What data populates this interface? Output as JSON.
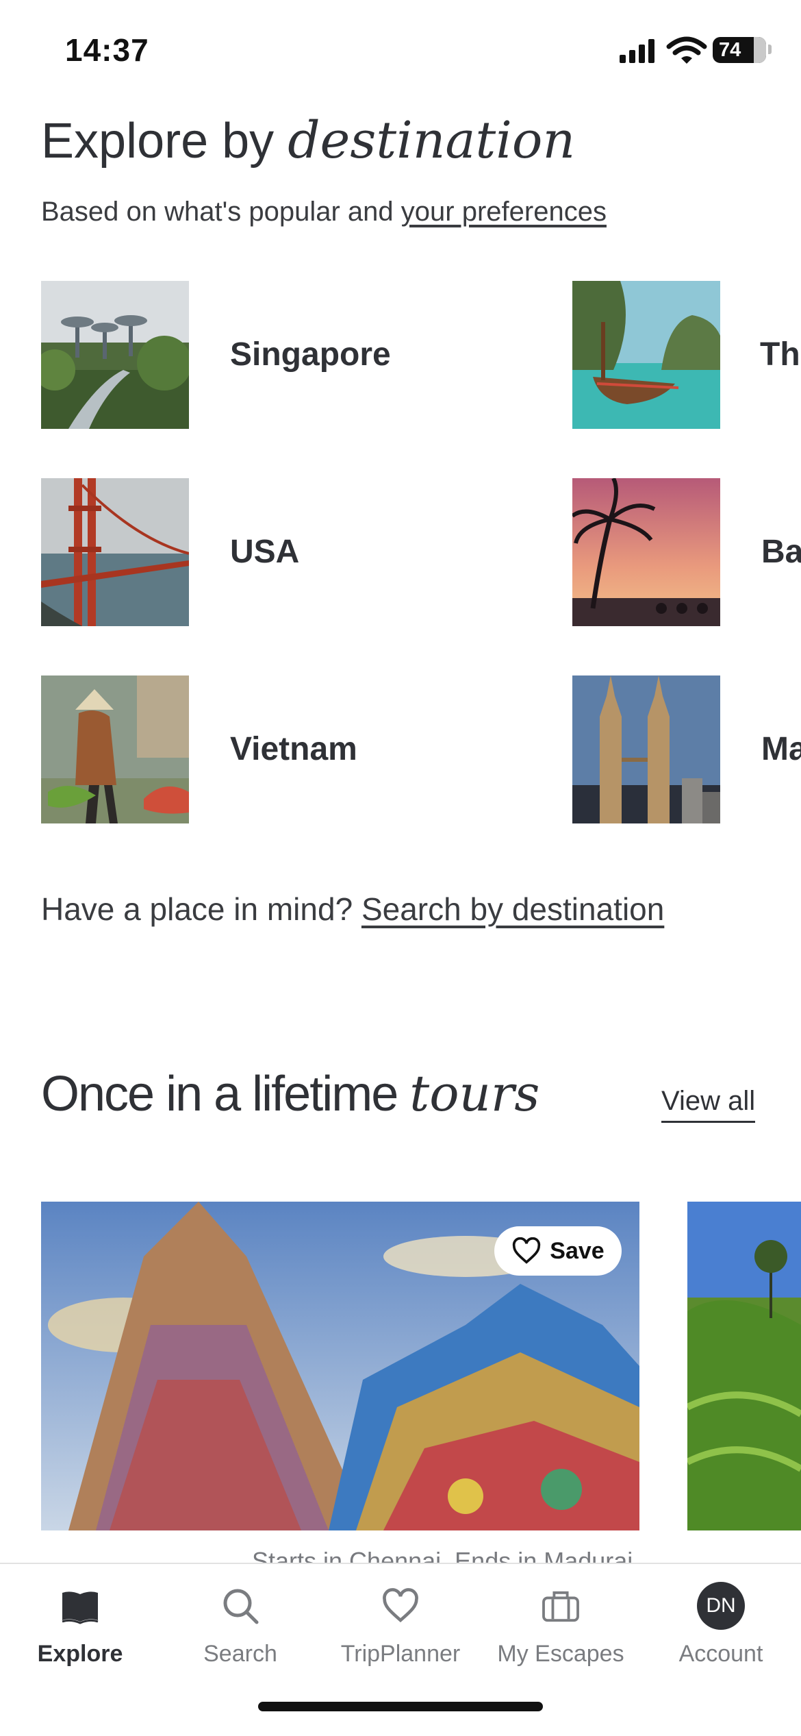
{
  "status": {
    "time": "14:37",
    "battery": "74"
  },
  "section_destinations": {
    "title": "Explore by",
    "title_emphasis": "destination",
    "subtitle": "Based on what's popular and",
    "subtitle_link": "your preferences",
    "items": [
      {
        "name": "Singapore"
      },
      {
        "name": "Th"
      },
      {
        "name": "USA"
      },
      {
        "name": "Ba"
      },
      {
        "name": "Vietnam"
      },
      {
        "name": "Ma"
      }
    ],
    "prompt": "Have a place in mind?",
    "prompt_link": "Search by destination"
  },
  "section_tours": {
    "title": "Once in a lifetime",
    "title_emphasis": "tours",
    "view_all": "View all",
    "save_label": "Save",
    "caption": "Starts in Chennai, Ends in Madurai"
  },
  "tabbar": {
    "tabs": [
      {
        "label": "Explore",
        "icon": "book-icon"
      },
      {
        "label": "Search",
        "icon": "search-icon"
      },
      {
        "label": "TripPlanner",
        "icon": "heart-icon"
      },
      {
        "label": "My Escapes",
        "icon": "suitcase-icon"
      },
      {
        "label": "Account",
        "icon": "avatar"
      }
    ],
    "avatar_initials": "DN"
  }
}
